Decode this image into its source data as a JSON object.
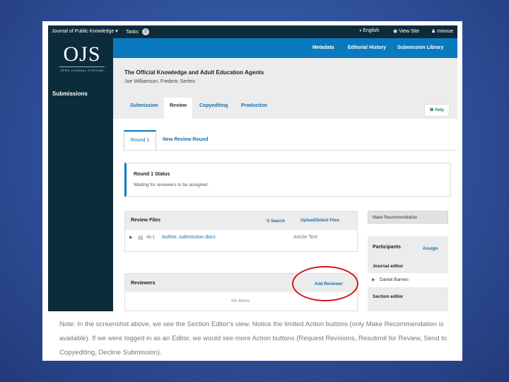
{
  "topbar": {
    "journal": "Journal of Public Knowledge",
    "tasks_label": "Tasks",
    "tasks_count": "1",
    "language": "English",
    "view_site": "View Site",
    "user": "minoue"
  },
  "logo": {
    "big": "OJS",
    "small": "OPEN JOURNAL SYSTEMS"
  },
  "sidebar": {
    "submissions": "Submissions"
  },
  "header_links": [
    "Metadata",
    "Editorial History",
    "Submission Library"
  ],
  "submission": {
    "title": "The Official Knowledge and Adult Education Agents",
    "authors": "Joe Williamson, Frederic Serleis"
  },
  "stage_tabs": [
    "Submission",
    "Review",
    "Copyediting",
    "Production"
  ],
  "help": "Help",
  "rounds": {
    "active": "Round 1",
    "new_round": "New Review Round"
  },
  "status": {
    "heading": "Round 1 Status",
    "text": "Waiting for reviewers to be assigned."
  },
  "review_files": {
    "heading": "Review Files",
    "search": "Search",
    "upload": "Upload/Select Files",
    "file": {
      "id": "48-1",
      "name": "Author, submission.docx",
      "component": "Article Text"
    }
  },
  "reviewers": {
    "heading": "Reviewers",
    "add": "Add Reviewer",
    "empty": "No Items"
  },
  "make_recommendation": "Make Recommendation",
  "participants": {
    "heading": "Participants",
    "assign": "Assign",
    "journal_editor": "Journal editor",
    "person": "Daniel Barnes",
    "section_editor": "Section editor"
  },
  "note": "Note: In the screenshot above, we see the Section Editor's view. Notice the limited Action buttons (only Make Recommendation is available). If we were logged in as an Editor, we would see more Action buttons (Request Revisions, Resubmit for Review, Send to Copyediting, Decline Submission).",
  "colors": {
    "navy": "#0d2b3a",
    "blue_header": "#0a7abf",
    "link": "#1a6ea8",
    "highlight_oval": "#d0181b",
    "help_green": "#2e8b57"
  }
}
